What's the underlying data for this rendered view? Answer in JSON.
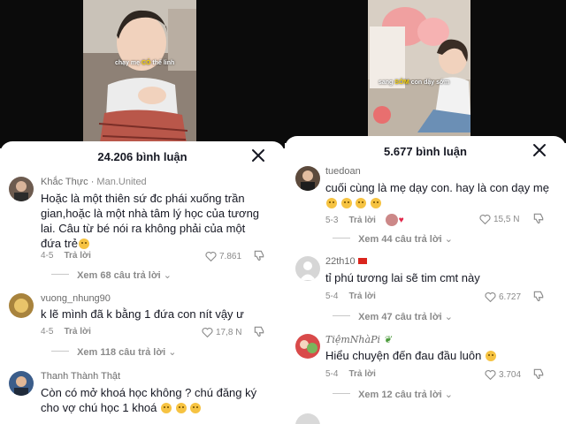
{
  "left": {
    "video": {
      "caption_pre": "chạy mẹ ",
      "caption_hl": "CÓ",
      "caption_post": " thể linh"
    },
    "header": {
      "count_label": "24.206 bình luận"
    },
    "comments": [
      {
        "name": "Khắc Thực",
        "tag": "Man.United",
        "text": "Hoặc là một thiên sứ đc phái xuống trần gian,hoặc là một nhà tâm lý học của tương lai. Câu từ bé nói ra không phải của một đứa trẻ",
        "emoji": [
          "grin"
        ],
        "date": "4-5",
        "reply": "Trả lời",
        "likes": "7.861",
        "view_replies": "Xem 68 câu trả lời"
      },
      {
        "name": "vuong_nhung90",
        "text": "k lẽ mình đã k bằng 1 đứa con nít vậy ư",
        "date": "4-5",
        "reply": "Trả lời",
        "likes": "17,8 N",
        "view_replies": "Xem 118 câu trả lời"
      },
      {
        "name": "Thanh Thành Thật",
        "text": "Còn có mở khoá học không ? chú đăng ký cho vợ chú học 1 khoá",
        "emoji": [
          "pleading",
          "pleading",
          "pleading"
        ]
      }
    ]
  },
  "right": {
    "video": {
      "caption_pre": "sang ",
      "caption_hl": "SỚM",
      "caption_post": " con dậy sớm"
    },
    "header": {
      "count_label": "5.677 bình luận"
    },
    "comments": [
      {
        "name": "tuedoan",
        "text": "cuối cùng là mẹ dạy con. hay là con dạy mẹ",
        "emoji": [
          "grin",
          "grin",
          "grin",
          "grin"
        ],
        "date": "5-3",
        "reply": "Trả lời",
        "likes": "15,5 N",
        "view_replies": "Xem 44 câu trả lời"
      },
      {
        "name": "22th10",
        "text": "tỉ phú tương lai sẽ tim cmt này",
        "date": "5-4",
        "reply": "Trả lời",
        "likes": "6.727",
        "view_replies": "Xem 47 câu trả lời"
      },
      {
        "name": "TiệmNhàPi",
        "text": "Hiểu chuyện đến đau đầu luôn",
        "emoji": [
          "laugh"
        ],
        "date": "5-4",
        "reply": "Trả lời",
        "likes": "3.704",
        "view_replies": "Xem 12 câu trả lời"
      }
    ]
  },
  "colors": {
    "text": "#161823",
    "muted": "#8a8a8a",
    "sheet": "#ffffff",
    "video_bg": "#0b0b0b",
    "caption_highlight": "#f7d20a"
  },
  "icons": [
    "close-icon",
    "heart-icon",
    "dislike-icon",
    "chevron-down-icon",
    "flag-icon"
  ]
}
